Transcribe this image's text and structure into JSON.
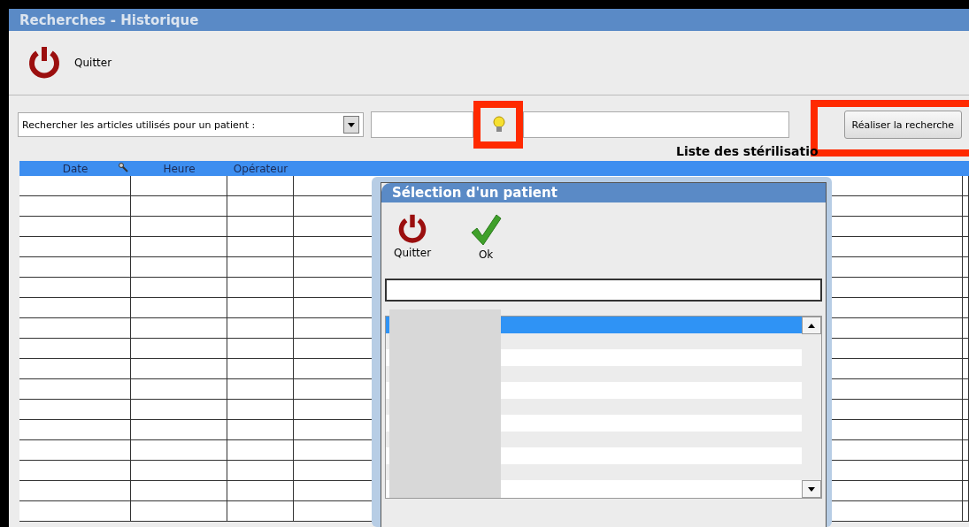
{
  "window": {
    "title": "Recherches - Historique"
  },
  "toolbar": {
    "quit_label": "Quitter"
  },
  "search": {
    "mode": "Rechercher les articles utilisés pour un patient :",
    "hint_highlighted": true,
    "button": "Réaliser la recherche",
    "button_highlighted": true
  },
  "list_title": "Liste des stérilisatio",
  "table": {
    "columns": [
      "Date",
      "Heure",
      "Opérateur"
    ]
  },
  "dialog": {
    "title": "Sélection d'un patient",
    "buttons": [
      {
        "kind": "quit",
        "label": "Quitter"
      },
      {
        "kind": "ok",
        "label": "Ok"
      }
    ],
    "items": [
      {
        "selected": true
      },
      {
        "selected": false
      },
      {
        "selected": false
      },
      {
        "selected": false
      },
      {
        "selected": false
      },
      {
        "selected": false
      },
      {
        "selected": false
      },
      {
        "selected": false
      },
      {
        "selected": false
      },
      {
        "selected": false
      },
      {
        "selected": false
      }
    ]
  }
}
